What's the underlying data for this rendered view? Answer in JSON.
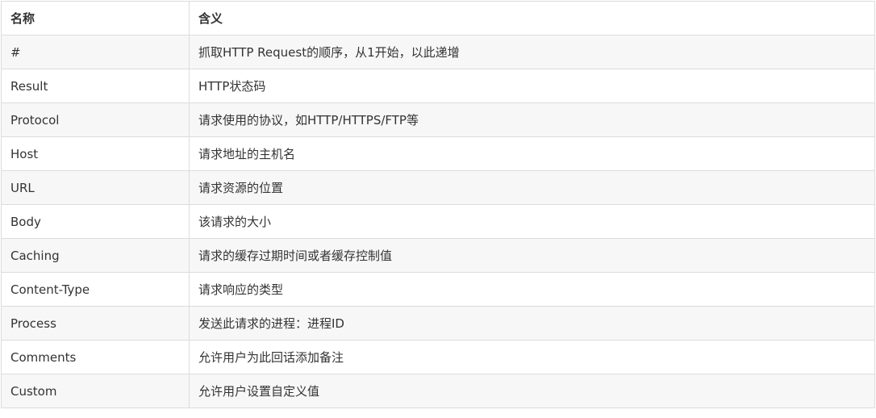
{
  "table": {
    "headers": [
      "名称",
      "含义"
    ],
    "rows": [
      [
        "#",
        "抓取HTTP Request的顺序，从1开始，以此递增"
      ],
      [
        "Result",
        "HTTP状态码"
      ],
      [
        "Protocol",
        "请求使用的协议，如HTTP/HTTPS/FTP等"
      ],
      [
        "Host",
        "请求地址的主机名"
      ],
      [
        "URL",
        "请求资源的位置"
      ],
      [
        "Body",
        "该请求的大小"
      ],
      [
        "Caching",
        "请求的缓存过期时间或者缓存控制值"
      ],
      [
        "Content-Type",
        "请求响应的类型"
      ],
      [
        "Process",
        "发送此请求的进程：进程ID"
      ],
      [
        "Comments",
        "允许用户为此回话添加备注"
      ],
      [
        "Custom",
        "允许用户设置自定义值"
      ]
    ]
  }
}
